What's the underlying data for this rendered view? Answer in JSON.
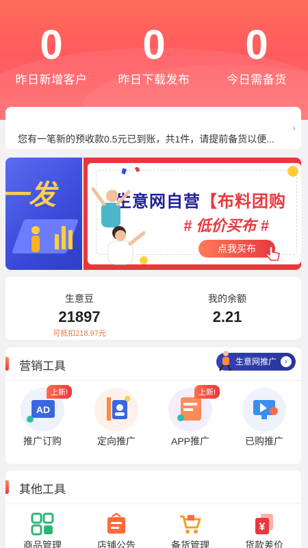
{
  "header": {
    "stats": [
      {
        "value": "0",
        "label": "昨日新增客户"
      },
      {
        "value": "0",
        "label": "昨日下载发布"
      },
      {
        "value": "0",
        "label": "今日需备货"
      }
    ]
  },
  "notice": {
    "text": "您有一笔新的预收款0.5元已到账，共1件，请提前备货以便...",
    "arrow": "›"
  },
  "banner": {
    "left_text": "一发",
    "title_a": "生意网自营",
    "title_b": "【布料团购",
    "subtitle": "# 低价买布 #",
    "button": "点我买布"
  },
  "wallet": {
    "beans_label": "生意豆",
    "beans_value": "21897",
    "beans_note": "可抵扣218.97元",
    "balance_label": "我的余额",
    "balance_value": "2.21"
  },
  "marketing": {
    "title": "营销工具",
    "promo_label": "生意网推广",
    "promo_arrow": "›",
    "items": [
      {
        "label": "推广订购",
        "tag": "上新!",
        "icon": "ad-icon"
      },
      {
        "label": "定向推广",
        "tag": "",
        "icon": "targeting-icon"
      },
      {
        "label": "APP推广",
        "tag": "上新!",
        "icon": "app-promo-icon"
      },
      {
        "label": "已购推广",
        "tag": "",
        "icon": "purchased-promo-icon"
      }
    ]
  },
  "other": {
    "title": "其他工具",
    "items": [
      {
        "label": "商品管理",
        "icon": "grid-icon"
      },
      {
        "label": "店铺公告",
        "icon": "notice-board-icon"
      },
      {
        "label": "备货管理",
        "icon": "cart-icon"
      },
      {
        "label": "货款差价",
        "icon": "yuan-icon"
      }
    ]
  },
  "colors": {
    "header": "#ff5b5f",
    "accent": "#e8383d",
    "navy": "#2a3599"
  }
}
